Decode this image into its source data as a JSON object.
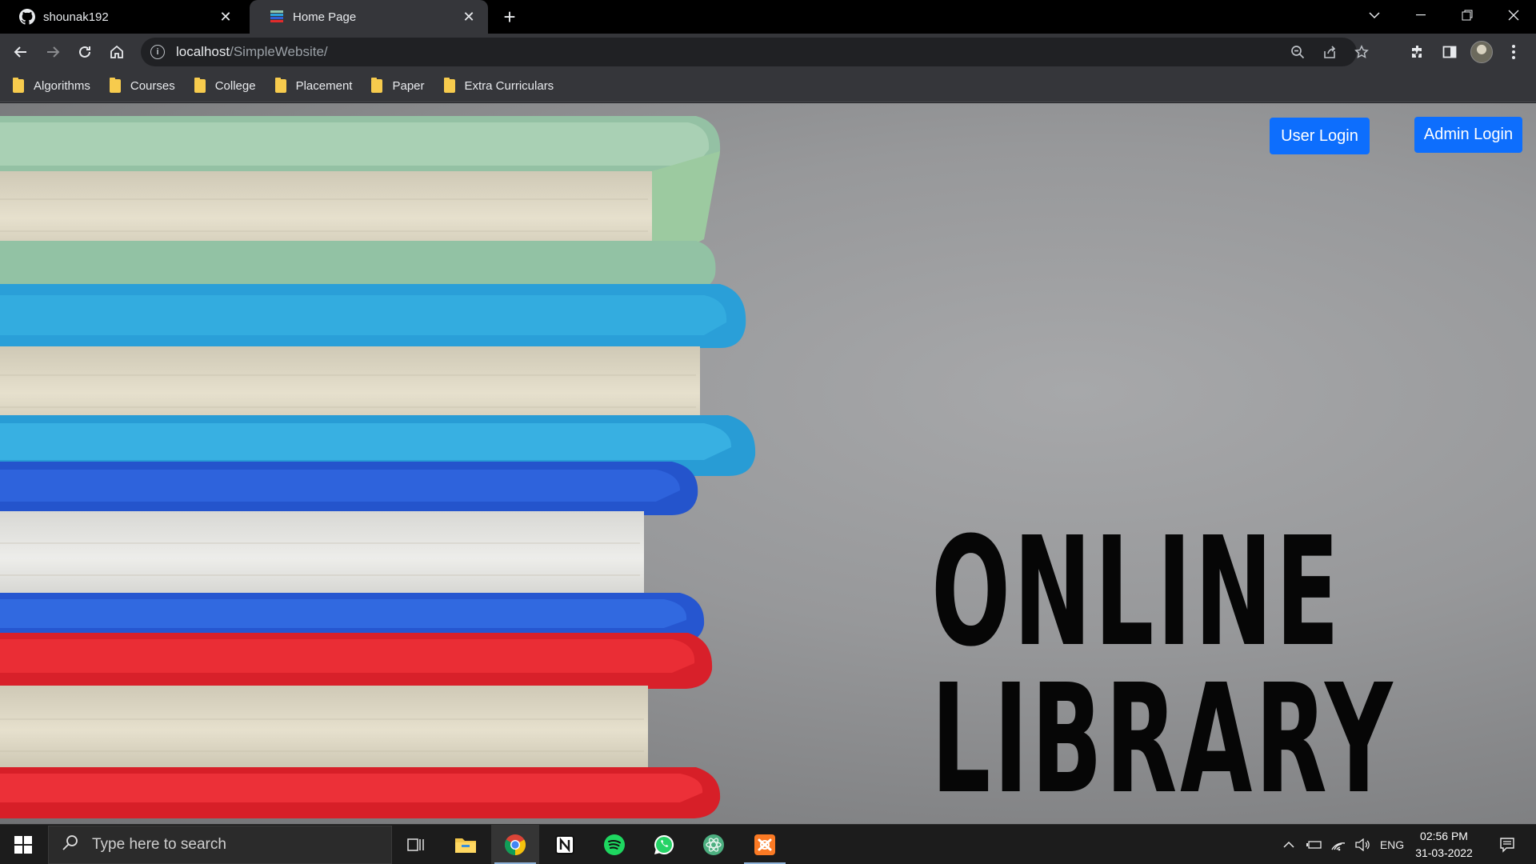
{
  "browser": {
    "tabs": [
      {
        "title": "shounak192",
        "icon": "github-icon",
        "active": false
      },
      {
        "title": "Home Page",
        "icon": "books-icon",
        "active": true
      }
    ],
    "url_host": "localhost",
    "url_path": "/SimpleWebsite/",
    "bookmarks": [
      "Algorithms",
      "Courses",
      "College",
      "Placement",
      "Paper",
      "Extra Curriculars"
    ]
  },
  "page": {
    "user_login": "User Login",
    "admin_login": "Admin Login",
    "title_line1": "ONLINE",
    "title_line2": "LIBRARY",
    "accent_color": "#0d6efd"
  },
  "taskbar": {
    "search_placeholder": "Type here to search",
    "language": "ENG",
    "time": "02:56 PM",
    "date": "31-03-2022"
  }
}
